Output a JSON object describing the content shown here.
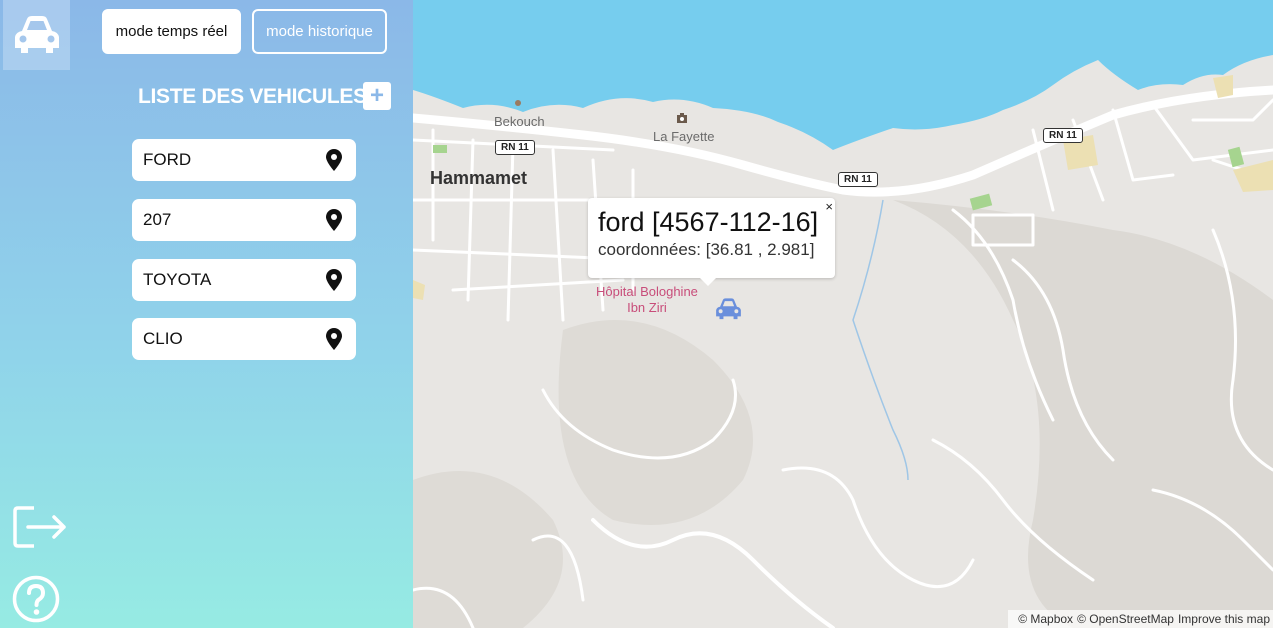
{
  "sidebar": {
    "car_icon": "car-icon",
    "mode_realtime_label": "mode temps réel",
    "mode_history_label": "mode historique",
    "list_title": "LISTE DES VEHICULES",
    "add_label": "+",
    "vehicles": [
      {
        "name": "FORD",
        "icon": "map-pin-icon"
      },
      {
        "name": "207",
        "icon": "map-pin-icon"
      },
      {
        "name": "TOYOTA",
        "icon": "map-pin-icon"
      },
      {
        "name": "CLIO",
        "icon": "map-pin-icon"
      }
    ],
    "logout_icon": "logout-icon",
    "help_icon": "help-icon"
  },
  "map": {
    "town": "Hammamet",
    "places": [
      "Bekouch",
      "La Fayette"
    ],
    "road_shields": [
      "RN 11",
      "RN 11",
      "RN 11"
    ],
    "hospital": [
      "Hôpital Bologhine",
      "Ibn Ziri"
    ],
    "popup": {
      "title": "ford [4567-112-16]",
      "coords": "coordonnées: [36.81 , 2.981]",
      "close": "×"
    },
    "attribution": {
      "mapbox": "© Mapbox",
      "osm": "© OpenStreetMap",
      "improve": "Improve this map"
    }
  },
  "colors": {
    "sea": "#76cdee",
    "land": "#e8e6e3",
    "sidebar_top": "#8bb8e8",
    "sidebar_bottom": "#96ebe3",
    "marker": "#6a8fdc"
  }
}
